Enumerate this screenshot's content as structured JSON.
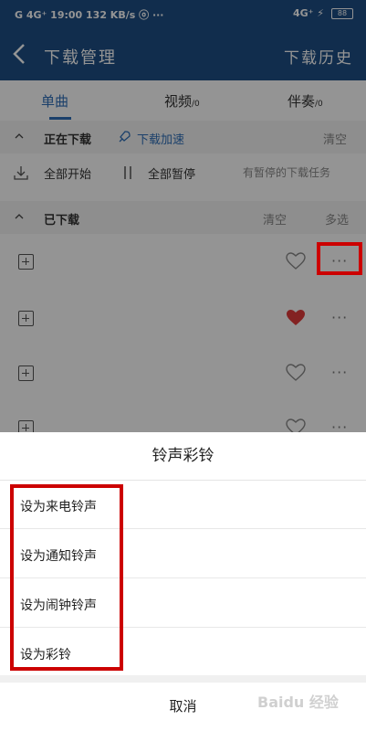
{
  "statusbar": {
    "left": "G 4G⁺ 19:00 132 KB/s  ⓞ ···",
    "right": "4G⁺ ⚡",
    "battery": "88"
  },
  "header": {
    "title": "下载管理",
    "history": "下载历史"
  },
  "tabs": [
    {
      "label": "单曲",
      "count": ""
    },
    {
      "label": "视频",
      "count": "/0"
    },
    {
      "label": "伴奏",
      "count": "/0"
    }
  ],
  "downloading": {
    "title": "正在下载",
    "accelerate": "下载加速",
    "clear": "清空",
    "start_all": "全部开始",
    "pause_all": "全部暂停",
    "paused_tasks": "有暂停的下载任务"
  },
  "downloaded": {
    "title": "已下载",
    "clear": "清空",
    "multi_select": "多选"
  },
  "sheet": {
    "title": "铃声彩铃",
    "items": [
      "设为来电铃声",
      "设为通知铃声",
      "设为闹钟铃声",
      "设为彩铃"
    ],
    "cancel": "取消"
  },
  "watermark": "Baidu 经验",
  "colors": {
    "header": "#1e4f86",
    "accent": "#2f6fb8",
    "highlight": "#cc0000",
    "liked": "#e23b3b"
  }
}
